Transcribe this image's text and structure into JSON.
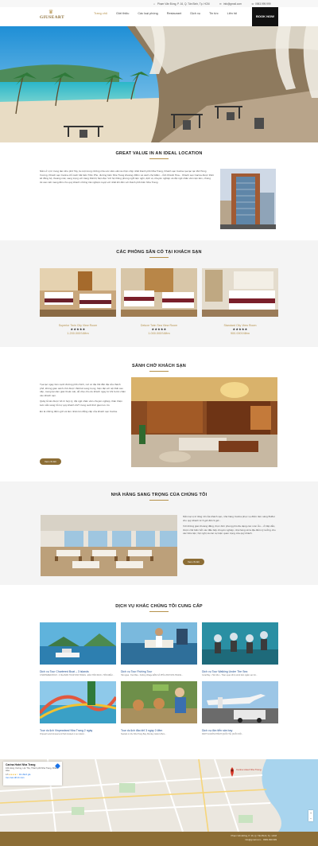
{
  "topbar": {
    "address": "Phạm Văn Đồng, P. 16, Q. Tân Bình, Tp. HCM",
    "email": "info@gmail.com",
    "phone": "0983.999.999"
  },
  "nav": {
    "logo_name": "GIUSEART",
    "items": [
      "Trang chủ",
      "Giới thiệu",
      "Các loại phòng",
      "Restaurant",
      "Dịch vụ",
      "Tin tức",
      "Liên hệ"
    ],
    "book_label": "BOOK NOW"
  },
  "intro": {
    "title": "GREAT VALUE IN AN IDEAL LOCATION",
    "text": "Nằm ở vị trí trung tâm khu phố Tây, là một trong những nhà sức sầm uất và nhộn nhịp nhất thành phố Nha Trang, Khách sạn Carina tọa lạc tại 164 Hùng Vương, Khách sạn Carina chỉ cách bãi biển Trần Phú, đường biển Nha Trang khoảng 200m và cách chợ Đầm – tỉnh Khánh Hòa... Khách sạn Carina được thiết kế đồng bộ, thoáng mát, sang trọng với trang thiết bị hiện đại. Với hệ thống phòng nghỉ tiện nghi, dịch vụ chuyên nghiệp và đội ngũ nhân viên tận tâm, chúng tôi cam kết mang đến cho quý khách những trải nghiệm tuyệt vời nhất khi đến với thành phố biển Nha Trang."
  },
  "rooms_section": {
    "title": "CÁC PHÒNG SẴN CÓ TẠI KHÁCH SẠN",
    "rooms": [
      {
        "name": "Superior Twin City View Room",
        "stars": "★★★★★",
        "price": "1.200.000₫/đêm"
      },
      {
        "name": "Deluxe Twin Sea View Room",
        "stars": "★★★★★",
        "price": "1.000.000₫/đêm"
      },
      {
        "name": "Standard City View Room",
        "stars": "★★★★★",
        "price": "900.000₫/đêm"
      }
    ]
  },
  "lobby": {
    "title": "SẢNH CHỜ KHÁCH SẠN",
    "p1": "Tọa lạc ngay bên cạnh đường phố chính, nơi có địa thế đắc địa của thành phố, không gian sảnh chờ được thiết kế sang trọng, hiện đại với nội thất cao cấp, mang lại cảm giác thoải mái, dễ chịu cho du khách ngay từ khi bước chân vào khách sạn.",
    "p2": "Quầy lễ tân được bố trí hợp lý, đội ngũ nhân viên chuyên nghiệp, thân thiện luôn sẵn sàng hỗ trợ quý khách 24/7 trong suốt thời gian lưu trú.",
    "p3": "Đó là những điểm giữ và làm nhân lên đẳng cấp của khách sạn Carina.",
    "button": "Xem chi tiết"
  },
  "restaurant": {
    "title": "NHÀ HÀNG SANG TRỌNG CỦA CHÚNG TÔI",
    "p1": "Nằm tại vị trí tầng 10 của khách sạn, nhà hàng Carina phục vụ điểm tâm sáng Buffet cho quý khách từ 6 giờ đến 9 giờ...",
    "p2": "Với không gian thoáng đãng, thực đơn phong phú đa dạng các món Âu – Á hấp dẫn, được chế biến bởi các đầu bếp chuyên nghiệp, nhà hàng sẽ là địa điểm lý tưởng cho các bữa tiệc, hội nghị và các sự kiện quan trọng của quý khách.",
    "button": "Xem chi tiết"
  },
  "services": {
    "title": "DỊCH VỤ KHÁC CHÚNG TÔI CUNG CẤP",
    "items": [
      {
        "title": "Dịch vụ Tour Chartered Boat – 3 islands",
        "desc": "CHARTERED BOAT - 3 ISLANDS TOUR NHA TRANG - ĐẢO HÒN MUN - HÒN MIỄU..."
      },
      {
        "title": "Dịch vụ Tour Fishing Tour",
        "desc": "Hải ngoại - Tam Bảo - Fishing Village ĐÂM CÁ PHÍA VỊNH NHA TRANG..."
      },
      {
        "title": "Dịch vụ Tour Walking Under The Sea",
        "desc": "Coral Bay - Hòn Mun - Tham quan đi bộ dưới biển ngắm san hô..."
      },
      {
        "title": "Tour du lịch Vinpearland Nha Trang 2 ngày",
        "desc": "Vinpearl Land Amusement Park located on an island..."
      },
      {
        "title": "Tour du lịch đảo khỉ 3 ngày 2 đêm",
        "desc": "Nestled on the Nha Trang Bay, Monkey Island offers..."
      },
      {
        "title": "Dịch vụ đón tiễn sân bay",
        "desc": "DỊCH VỤ ĐÓN KHÁCH QUỐC TẾ, QUỐC NỘI..."
      }
    ]
  },
  "map": {
    "place_name": "Carina Hotel Nha Trang",
    "place_address": "164 Hùng Vương, Lộc Thọ, Thành phố Nha Trang, Khánh Hòa",
    "rating": "4.5",
    "rating_stars": "★★★★☆",
    "reviews": "111 đánh giá",
    "link": "Xem bản đồ lớn hơn",
    "pin_label": "Carina Hotel Nha Trang"
  },
  "footer": {
    "address": "Phạm Văn Đồng, P. 16, Q. Tân Bình, Tp. HCM",
    "email": "info@gmail.com",
    "phone": "0983.999.999"
  },
  "colors": {
    "gold": "#8c6d35",
    "accent": "#b5924c",
    "link_blue": "#1e4d8f"
  }
}
